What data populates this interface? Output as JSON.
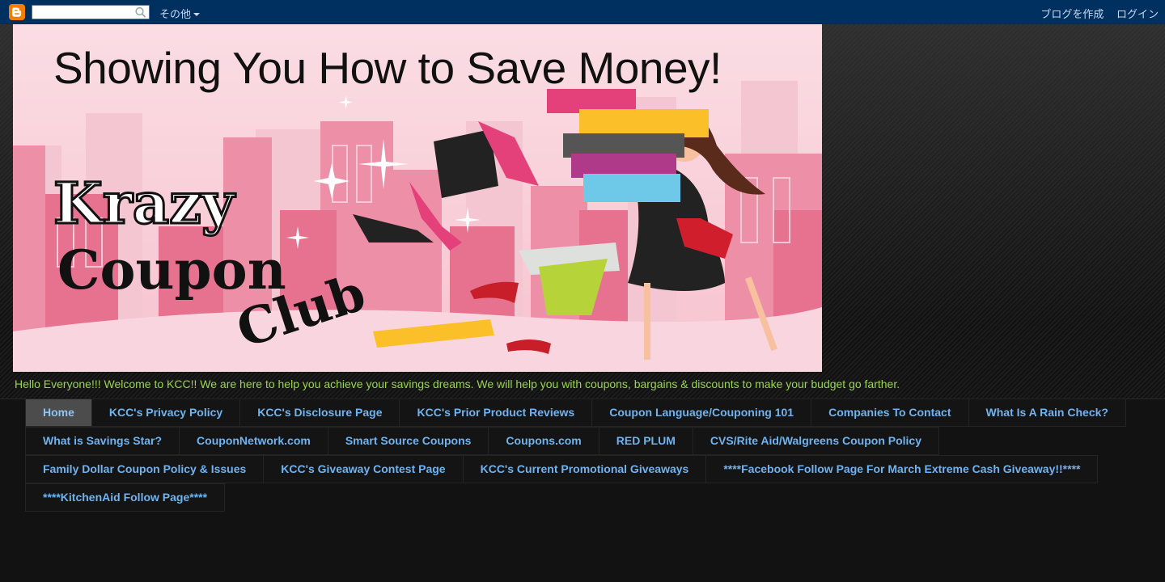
{
  "navbar": {
    "logo_icon": "blogger-icon",
    "search_placeholder": "",
    "search_icon": "magnifier-icon",
    "more_label": "その他",
    "create_blog_label": "ブログを作成",
    "login_label": "ログイン"
  },
  "header": {
    "tagline": "Showing You How to Save Money!",
    "logo_line1": "Krazy",
    "logo_line2": "Coupon",
    "logo_line3": "Club"
  },
  "description": "Hello Everyone!!! Welcome to KCC!! We are here to help you achieve your savings dreams. We will help you with coupons, bargains & discounts to make your budget go farther.",
  "tabs": {
    "row1": [
      {
        "label": "Home",
        "active": true
      },
      {
        "label": "KCC's Privacy Policy"
      },
      {
        "label": "KCC's Disclosure Page"
      },
      {
        "label": "KCC's Prior Product Reviews"
      },
      {
        "label": "Coupon Language/Couponing 101"
      },
      {
        "label": "Companies To Contact"
      },
      {
        "label": "What Is A Rain Check?"
      }
    ],
    "row2": [
      {
        "label": "What is Savings Star?"
      },
      {
        "label": "CouponNetwork.com"
      },
      {
        "label": "Smart Source Coupons"
      },
      {
        "label": "Coupons.com"
      },
      {
        "label": "RED PLUM"
      },
      {
        "label": "CVS/Rite Aid/Walgreens Coupon Policy"
      }
    ],
    "row3": [
      {
        "label": "Family Dollar Coupon Policy & Issues"
      },
      {
        "label": "KCC's Giveaway Contest Page"
      },
      {
        "label": "KCC's Current Promotional Giveaways"
      },
      {
        "label": "****Facebook Follow Page For March Extreme Cash Giveaway!!****"
      }
    ],
    "row4": [
      {
        "label": "****KitchenAid Follow Page****"
      }
    ]
  },
  "colors": {
    "navbar_bg": "#00305f",
    "link_blue": "#6fb3f0",
    "description_green": "#9ad54a",
    "blogger_orange": "#f57d00"
  }
}
